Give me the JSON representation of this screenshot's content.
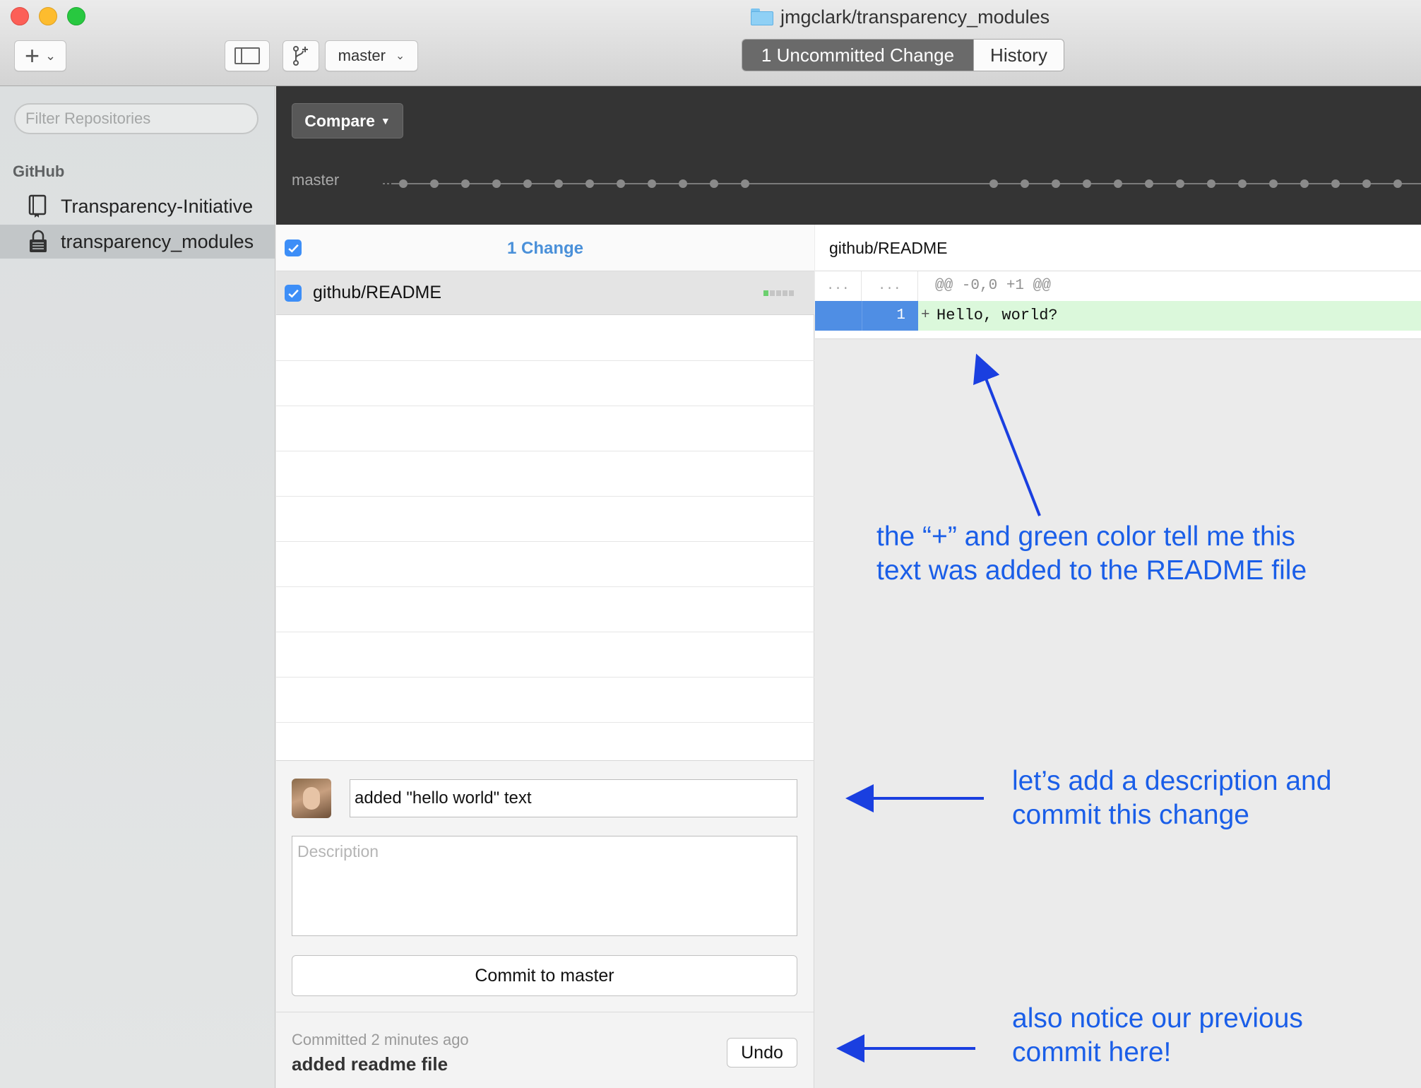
{
  "window": {
    "title": "jmgclark/transparency_modules"
  },
  "toolbar": {
    "add_icon": "plus-icon",
    "branch_name": "master",
    "tabs": [
      {
        "label": "1 Uncommitted Change",
        "active": true
      },
      {
        "label": "History",
        "active": false
      }
    ]
  },
  "sidebar": {
    "filter_placeholder": "Filter Repositories",
    "section_title": "GitHub",
    "repos": [
      {
        "name": "Transparency-Initiative",
        "icon": "book-icon",
        "selected": false
      },
      {
        "name": "transparency_modules",
        "icon": "lock-icon",
        "selected": true
      }
    ]
  },
  "header": {
    "compare_label": "Compare",
    "timeline_branch": "master"
  },
  "changes": {
    "count_label": "1 Change",
    "files": [
      {
        "path": "github/README",
        "checked": true
      }
    ]
  },
  "commit": {
    "summary_value": "added \"hello world\" text",
    "description_placeholder": "Description",
    "button_label": "Commit to master"
  },
  "last_commit": {
    "time_label": "Committed 2 minutes ago",
    "message": "added readme file",
    "undo_label": "Undo"
  },
  "diff": {
    "filename": "github/README",
    "hunk_gutter_old": "...",
    "hunk_gutter_new": "...",
    "hunk_header": "@@ -0,0 +1 @@",
    "lines": [
      {
        "new_line_no": "1",
        "sign": "+",
        "text": "Hello, world?"
      }
    ]
  },
  "annotations": {
    "note_1": "the “+” and green color tell me this text was added to the README file",
    "note_2": "let’s add a description and commit this change",
    "note_3": "also notice our previous commit here!"
  },
  "colors": {
    "accent_blue": "#3d8ef7",
    "annotation_blue": "#1a5ee8",
    "added_line_bg": "#dbf8db",
    "line_number_bg": "#4f8ee4",
    "dark_header_bg": "#343434"
  }
}
